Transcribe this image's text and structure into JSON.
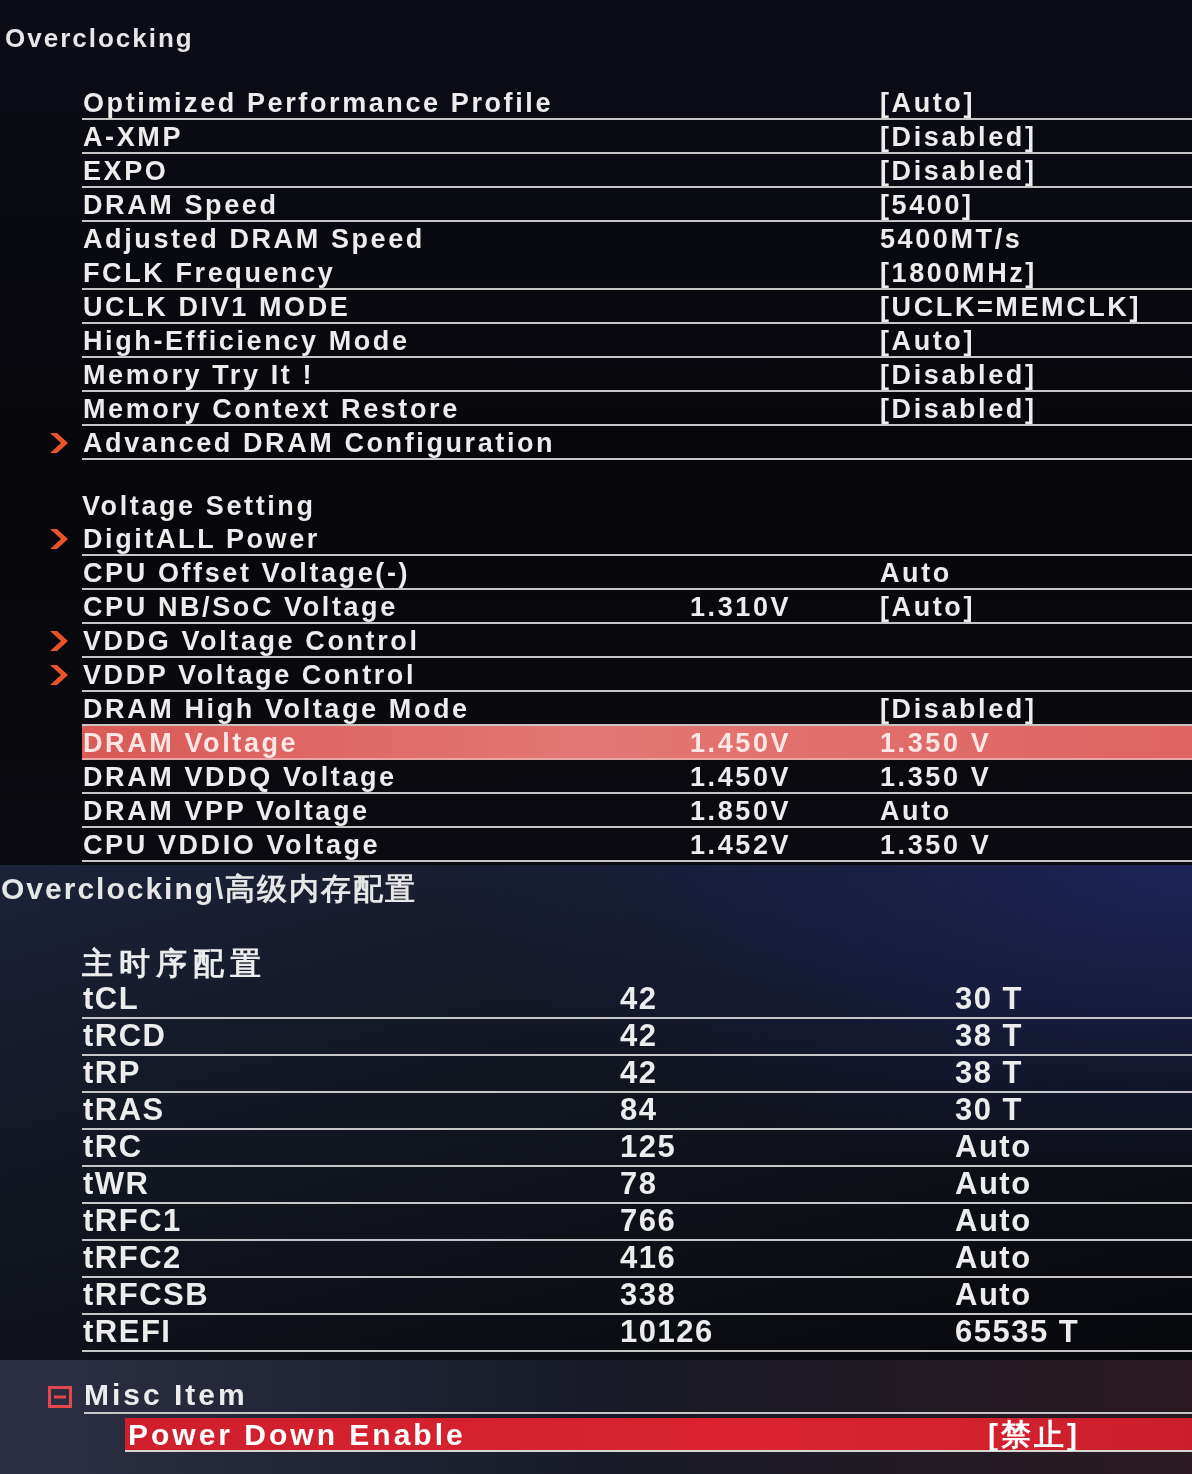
{
  "panels": [
    {
      "title": "Overclocking",
      "items": [
        {
          "kind": "setting",
          "label": "Optimized Performance Profile",
          "value": "[Auto]",
          "submenu": false,
          "selected": false
        },
        {
          "kind": "setting",
          "label": "A-XMP",
          "value": "[Disabled]",
          "submenu": false,
          "selected": false
        },
        {
          "kind": "setting",
          "label": "EXPO",
          "value": "[Disabled]",
          "submenu": false,
          "selected": false
        },
        {
          "kind": "setting",
          "label": "DRAM Speed",
          "value": "[5400]",
          "submenu": false,
          "selected": false
        },
        {
          "kind": "info",
          "label": "Adjusted DRAM Speed",
          "value": "5400MT/s",
          "submenu": false,
          "selected": false
        },
        {
          "kind": "setting",
          "label": "FCLK Frequency",
          "value": "[1800MHz]",
          "submenu": false,
          "selected": false
        },
        {
          "kind": "setting",
          "label": "UCLK DIV1 MODE",
          "value": "[UCLK=MEMCLK]",
          "submenu": false,
          "selected": false
        },
        {
          "kind": "setting",
          "label": "High-Efficiency Mode",
          "value": "[Auto]",
          "submenu": false,
          "selected": false
        },
        {
          "kind": "setting",
          "label": "Memory Try It !",
          "value": "[Disabled]",
          "submenu": false,
          "selected": false
        },
        {
          "kind": "setting",
          "label": "Memory Context Restore",
          "value": "[Disabled]",
          "submenu": false,
          "selected": false
        },
        {
          "kind": "setting",
          "label": "Advanced DRAM Configuration",
          "submenu": true,
          "selected": false
        },
        {
          "kind": "heading",
          "label": "Voltage Setting",
          "submenu": false,
          "selected": false
        },
        {
          "kind": "setting",
          "label": "DigitALL Power",
          "submenu": true,
          "selected": false
        },
        {
          "kind": "setting",
          "label": "CPU Offset Voltage(-)",
          "value": "Auto",
          "submenu": false,
          "selected": false
        },
        {
          "kind": "setting",
          "label": "CPU NB/SoC Voltage",
          "reading": "1.310V",
          "value": "[Auto]",
          "submenu": false,
          "selected": false
        },
        {
          "kind": "setting",
          "label": "VDDG Voltage Control",
          "submenu": true,
          "selected": false
        },
        {
          "kind": "setting",
          "label": "VDDP Voltage Control",
          "submenu": true,
          "selected": false
        },
        {
          "kind": "setting",
          "label": "DRAM High Voltage Mode",
          "value": "[Disabled]",
          "submenu": false,
          "selected": false
        },
        {
          "kind": "setting",
          "label": "DRAM Voltage",
          "reading": "1.450V",
          "value": "1.350 V",
          "submenu": false,
          "selected": true
        },
        {
          "kind": "setting",
          "label": "DRAM VDDQ Voltage",
          "reading": "1.450V",
          "value": "1.350 V",
          "submenu": false,
          "selected": false
        },
        {
          "kind": "setting",
          "label": "DRAM VPP Voltage",
          "reading": "1.850V",
          "value": "Auto",
          "submenu": false,
          "selected": false
        },
        {
          "kind": "setting",
          "label": "CPU VDDIO Voltage",
          "reading": "1.452V",
          "value": "1.350 V",
          "submenu": false,
          "selected": false
        }
      ]
    },
    {
      "title": "Overclocking\\高级内存配置",
      "items": [
        {
          "kind": "heading",
          "label": "主时序配置",
          "submenu": false,
          "selected": false
        },
        {
          "kind": "setting",
          "label": "tCL",
          "reading": "42",
          "value": "30 T",
          "submenu": false,
          "selected": false
        },
        {
          "kind": "setting",
          "label": "tRCD",
          "reading": "42",
          "value": "38 T",
          "submenu": false,
          "selected": false
        },
        {
          "kind": "setting",
          "label": "tRP",
          "reading": "42",
          "value": "38 T",
          "submenu": false,
          "selected": false
        },
        {
          "kind": "setting",
          "label": "tRAS",
          "reading": "84",
          "value": "30 T",
          "submenu": false,
          "selected": false
        },
        {
          "kind": "setting",
          "label": "tRC",
          "reading": "125",
          "value": "Auto",
          "submenu": false,
          "selected": false
        },
        {
          "kind": "setting",
          "label": "tWR",
          "reading": "78",
          "value": "Auto",
          "submenu": false,
          "selected": false
        },
        {
          "kind": "setting",
          "label": "tRFC1",
          "reading": "766",
          "value": "Auto",
          "submenu": false,
          "selected": false
        },
        {
          "kind": "setting",
          "label": "tRFC2",
          "reading": "416",
          "value": "Auto",
          "submenu": false,
          "selected": false
        },
        {
          "kind": "setting",
          "label": "tRFCSB",
          "reading": "338",
          "value": "Auto",
          "submenu": false,
          "selected": false
        },
        {
          "kind": "setting",
          "label": "tREFI",
          "reading": "10126",
          "value": "65535 T",
          "submenu": false,
          "selected": false
        }
      ]
    },
    {
      "items": [
        {
          "kind": "group",
          "label": "Misc Item",
          "expanded": true,
          "selected": false,
          "children": [
            {
              "kind": "setting",
              "label": "Power Down Enable",
              "value": "[禁止]",
              "submenu": false,
              "selected": true
            }
          ]
        }
      ]
    }
  ]
}
